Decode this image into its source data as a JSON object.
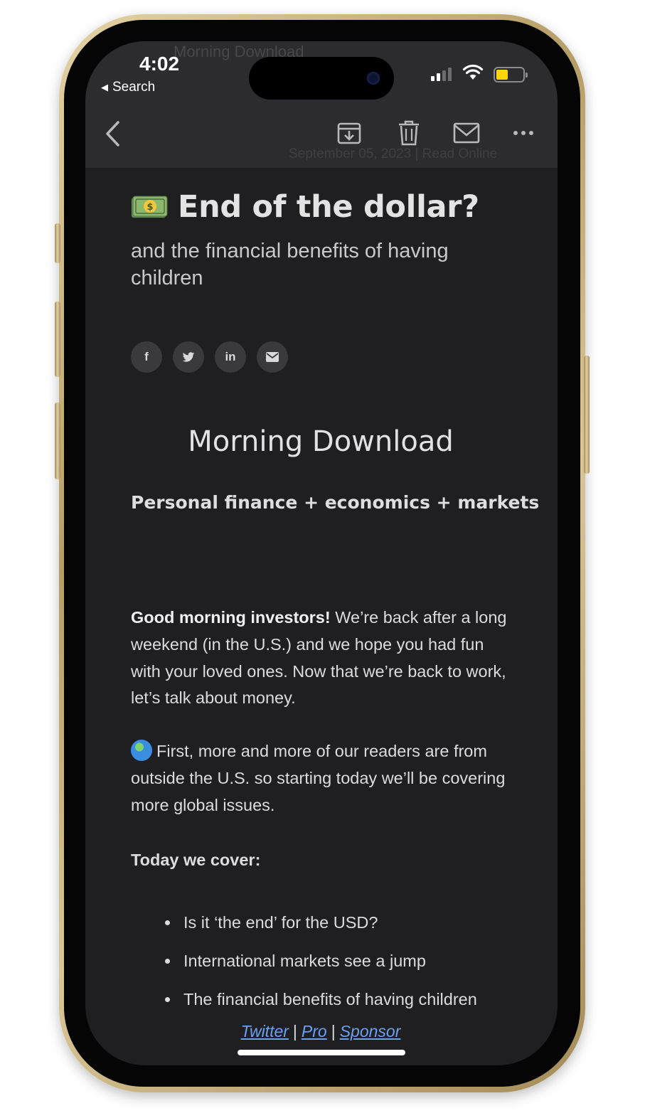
{
  "status_bar": {
    "time": "4:02",
    "back_label": "Search",
    "battery_color": "#ffd60a"
  },
  "background": {
    "ghost_sender": "Morning Download",
    "ghost_date": "September 05, 2023  |  Read Online"
  },
  "toolbar": {
    "icons": [
      "chevron-left-icon",
      "archive-icon",
      "trash-icon",
      "envelope-icon",
      "more-icon"
    ]
  },
  "email": {
    "title": "End of the dollar?",
    "title_icon": "dollar-banknote-icon",
    "subtitle": "and the financial benefits of having children",
    "share": [
      {
        "name": "facebook",
        "glyph": "f"
      },
      {
        "name": "twitter",
        "glyph": ""
      },
      {
        "name": "linkedin",
        "glyph": "in"
      },
      {
        "name": "email",
        "glyph": ""
      }
    ],
    "brand": "Morning Download",
    "tagline": "Personal finance + economics + markets",
    "greeting_bold": "Good morning investors!",
    "greeting_rest": " We’re back after a long weekend (in the U.S.) and we hope you had fun with your loved ones. Now that we’re back to work, let’s talk about money.",
    "global_note": "First, more and more of our readers are from outside the U.S. so starting today we’ll be covering more global issues.",
    "cover_heading": "Today we cover:",
    "cover_items": [
      "Is it ‘the end’ for the USD?",
      "International markets see a jump",
      "The financial benefits of having children"
    ],
    "footer_links": [
      "Twitter",
      "Pro",
      "Sponsor"
    ],
    "footer_separator": "|",
    "link_color": "#6aa0f2"
  }
}
